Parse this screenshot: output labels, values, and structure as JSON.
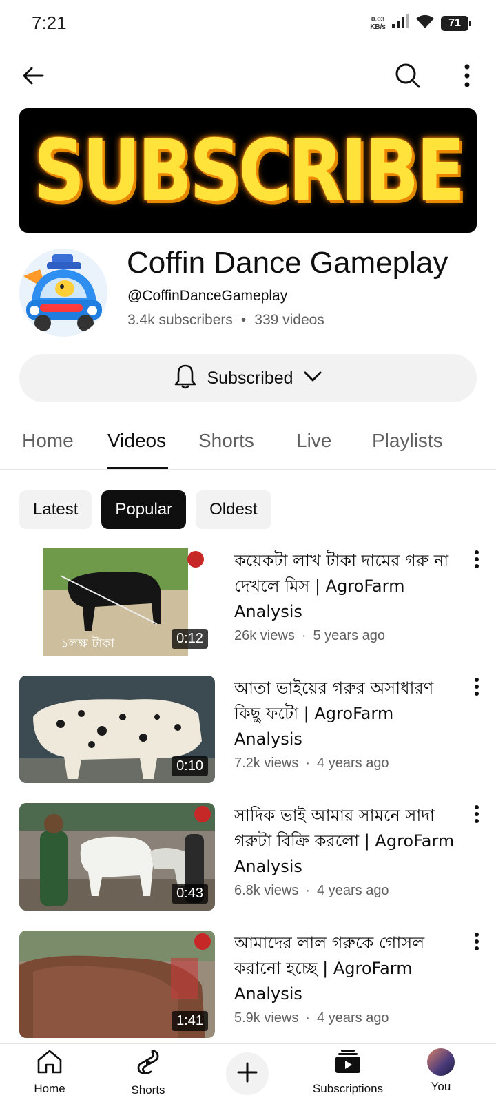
{
  "status": {
    "time": "7:21",
    "net_speed_value": "0.03",
    "net_speed_unit": "KB/s",
    "battery": "71"
  },
  "banner": {
    "text": "SUBSCRIBE"
  },
  "channel": {
    "name": "Coffin Dance Gameplay",
    "handle": "@CoffinDanceGameplay",
    "subscribers": "3.4k subscribers",
    "separator": "•",
    "videos": "339 videos"
  },
  "subscribe_button": {
    "label": "Subscribed"
  },
  "tabs": [
    {
      "label": "Home"
    },
    {
      "label": "Videos"
    },
    {
      "label": "Shorts"
    },
    {
      "label": "Live"
    },
    {
      "label": "Playlists"
    }
  ],
  "active_tab": "Videos",
  "chips": [
    {
      "label": "Latest"
    },
    {
      "label": "Popular"
    },
    {
      "label": "Oldest"
    }
  ],
  "active_chip": "Popular",
  "videos": [
    {
      "title": "কয়েকটা লাখ টাকা দামের গরু না দেখলে মিস | AgroFarm Analysis",
      "views": "26k views",
      "dot": "·",
      "age": "5 years ago",
      "duration": "0:12",
      "thumb_caption": "১লক্ষ টাকা"
    },
    {
      "title": "আতা ভাইয়ের গরুর অসাধারণ কিছু ফটো | AgroFarm Analysis",
      "views": "7.2k views",
      "dot": "·",
      "age": "4 years ago",
      "duration": "0:10"
    },
    {
      "title": "সাদিক ভাই আমার সামনে সাদা গরুটা বিক্রি করলো | AgroFarm Analysis",
      "views": "6.8k views",
      "dot": "·",
      "age": "4 years ago",
      "duration": "0:43"
    },
    {
      "title": "আমাদের লাল গরুকে গোসল করানো হচ্ছে | AgroFarm Analysis",
      "views": "5.9k views",
      "dot": "·",
      "age": "4 years ago",
      "duration": "1:41"
    }
  ],
  "bottom_nav": {
    "home": "Home",
    "shorts": "Shorts",
    "subscriptions": "Subscriptions",
    "you": "You"
  }
}
